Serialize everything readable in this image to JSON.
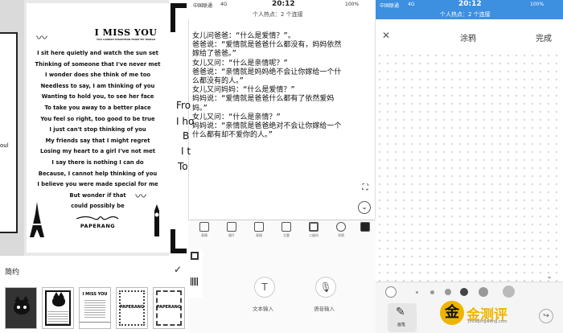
{
  "panel1": {
    "left_fragment": "oul",
    "paper": {
      "title": "I MISS YOU",
      "subtitle": "YOU CANNOT DISAPPEAR FROM MY WORLD",
      "lines": [
        "I sit here quietly and watch the sun set",
        "Thinking of someone that I've never met",
        "I wonder does she think of me too",
        "Needless to say, I am thinking of you",
        "Wanting to hold you, to see her face",
        "To take you away to a better place",
        "You feel so right, too good to be true",
        "I just can't stop thinking of you",
        "My friends say that I might regret",
        "Losing my heart to a girl I've not met",
        "I say there is nothing I can do",
        "Because, I cannot help thinking of you",
        "I believe you were made special for me",
        "But wonder if that",
        "could possibly be"
      ],
      "brand": "PAPERANG"
    },
    "template_label": "简约",
    "check_icon": "check-icon",
    "thumbnails": [
      {
        "name": "cat",
        "text": ""
      },
      {
        "name": "cat-frame",
        "text": ""
      },
      {
        "name": "i-miss-you",
        "text": "I MISS YOU"
      },
      {
        "name": "paperang-plain",
        "text": "PAPERANG"
      },
      {
        "name": "paperang-dots",
        "text": "PAPERANG"
      }
    ]
  },
  "panel2": {
    "status": {
      "carrier": "中国联通",
      "network": "4G",
      "time": "20:12",
      "battery": "100%",
      "hotspot": "个人热点：2 个连接"
    },
    "text_lines": [
      "女儿问爸爸：“什么是爱情？”。",
      "爸爸说：“爱情就是爸爸什么都没有，妈妈依然",
      "嫁给了爸爸。”",
      "女儿又问：“什么是亲情呢？”",
      "爸爸说：“亲情就是妈妈绝不会让你嫁给一个什",
      "么都没有的人。”",
      "女儿又问妈妈：“什么是爱情？”",
      "妈妈说：“爱情就是爸爸什么都有了依然爱妈",
      "妈。”",
      "女儿又问：“什么是亲情？”",
      "妈妈说：“亲情就是爸爸绝对不会让你嫁给一个",
      "什么都有却不爱你的人。”"
    ],
    "toolbar": [
      {
        "label": "表情",
        "icon": "emoji-icon"
      },
      {
        "label": "图片",
        "icon": "image-icon"
      },
      {
        "label": "表格",
        "icon": "table-icon"
      },
      {
        "label": "主题",
        "icon": "shirt-icon"
      },
      {
        "label": "二维码",
        "icon": "qrcode-icon"
      },
      {
        "label": "涂鸦",
        "icon": "pen-icon"
      },
      {
        "label": "",
        "icon": "printer-icon"
      }
    ],
    "text_input_label": "文本输入",
    "voice_input_label": "语音输入",
    "peek_lines": [
      "Fro",
      "I ho",
      "B",
      "I t",
      "To"
    ]
  },
  "panel3": {
    "status": {
      "carrier": "中国联通",
      "network": "4G",
      "time": "20:12",
      "battery": "100%",
      "hotspot": "个人热点：2 个连接"
    },
    "title": "涂鸦",
    "done_label": "完成",
    "pen_label": "画笔",
    "watermark_cn": "金测评",
    "watermark_url": "jincepingwang.com"
  },
  "colors": {
    "blue_status": "#3d8fe0",
    "watermark_gold": "#f0b400"
  }
}
